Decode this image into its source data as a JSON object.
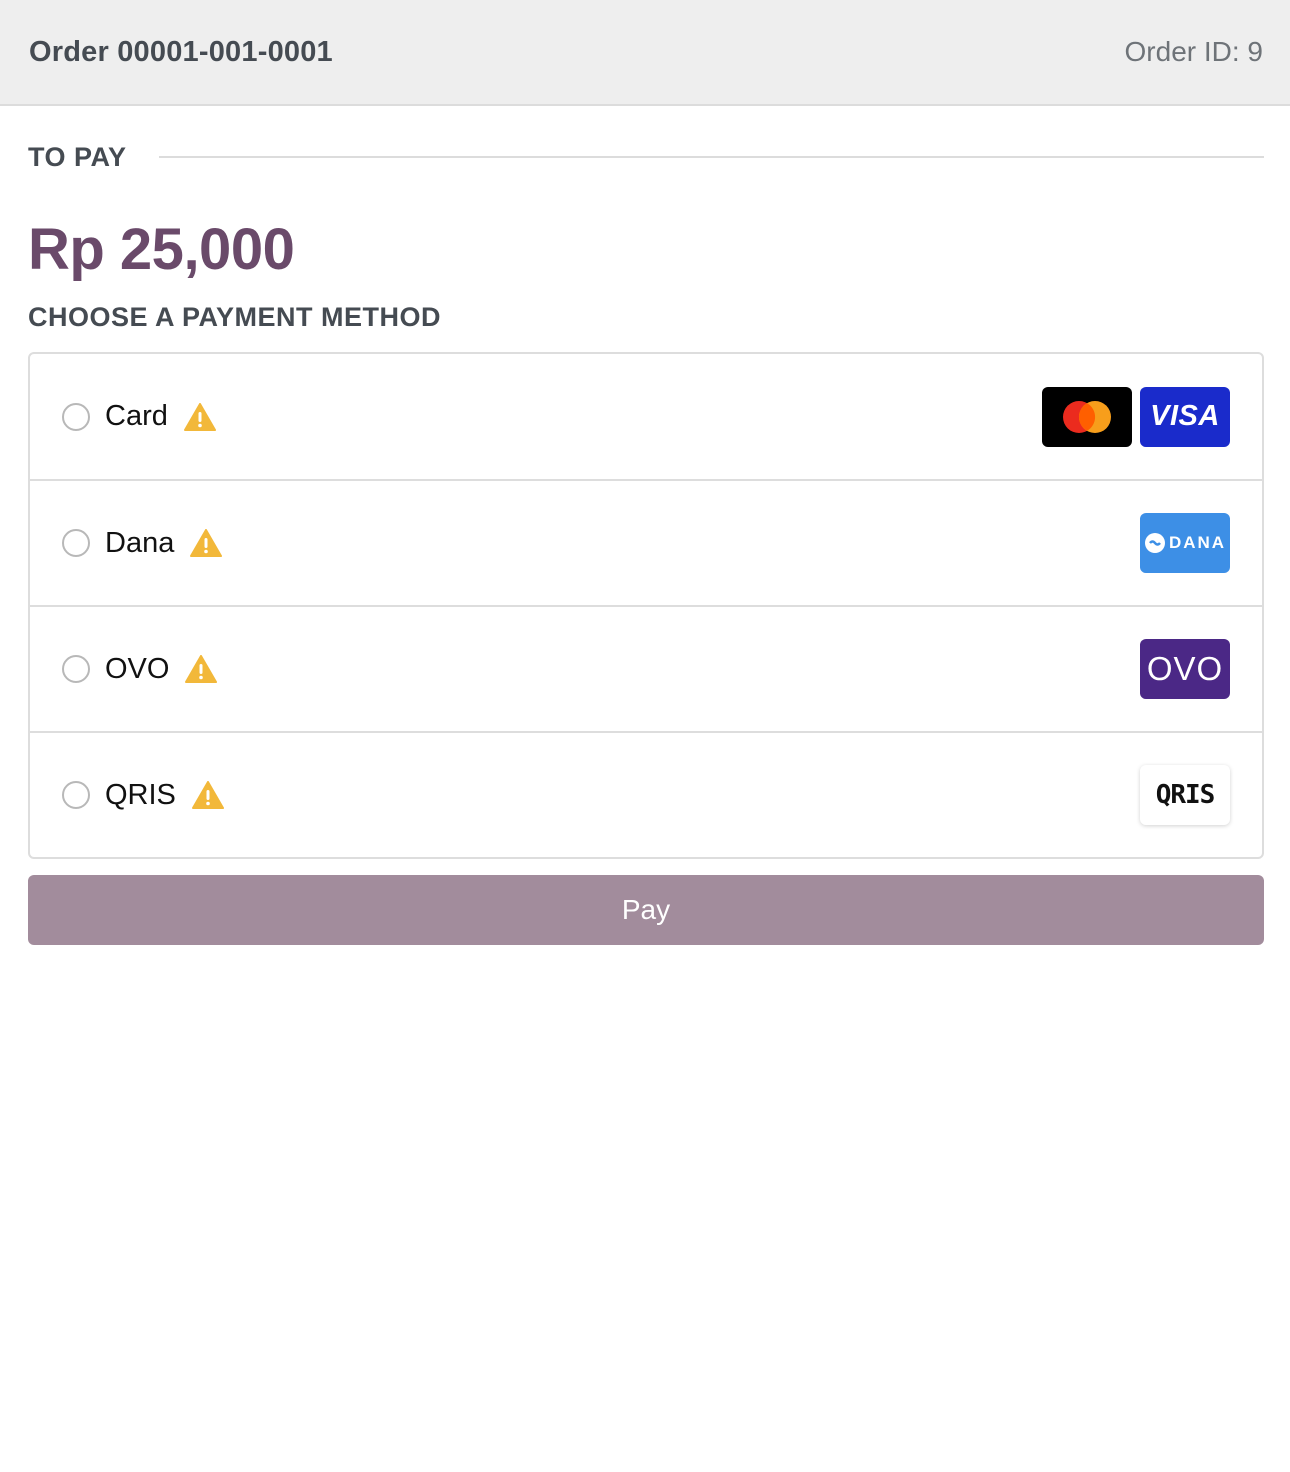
{
  "header": {
    "order_title": "Order 00001-001-0001",
    "order_id": "Order ID: 9"
  },
  "to_pay": {
    "label": "TO PAY",
    "amount": "Rp 25,000"
  },
  "payment": {
    "heading": "CHOOSE A PAYMENT METHOD",
    "methods": [
      {
        "label": "Card",
        "icon": "warning-icon",
        "logos": [
          "mastercard-logo",
          "visa-logo"
        ],
        "visa_text": "VISA"
      },
      {
        "label": "Dana",
        "icon": "warning-icon",
        "logos": [
          "dana-logo"
        ],
        "logo_text": "DANA"
      },
      {
        "label": "OVO",
        "icon": "warning-icon",
        "logos": [
          "ovo-logo"
        ],
        "logo_text": "OVO"
      },
      {
        "label": "QRIS",
        "icon": "warning-icon",
        "logos": [
          "qris-logo"
        ],
        "logo_text": "QRIS"
      }
    ]
  },
  "pay_button": {
    "label": "Pay"
  },
  "colors": {
    "accent": "#6a4a6a",
    "pay_button": "#a28c9c",
    "warning": "#f2b83a",
    "visa": "#1a2bcb",
    "dana": "#3d8fe6",
    "ovo": "#4b2886"
  }
}
